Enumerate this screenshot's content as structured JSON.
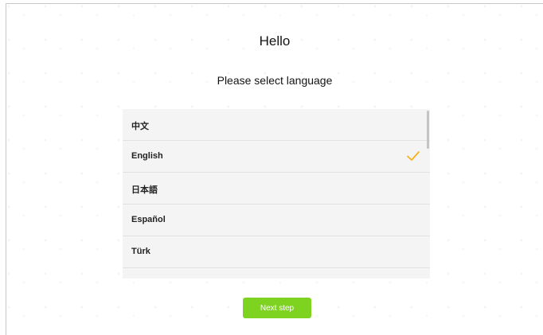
{
  "header": {
    "greeting": "Hello",
    "subtitle": "Please select language"
  },
  "languages": [
    {
      "label": "中文",
      "selected": false
    },
    {
      "label": "English",
      "selected": true
    },
    {
      "label": "日本語",
      "selected": false
    },
    {
      "label": "Español",
      "selected": false
    },
    {
      "label": "Türk",
      "selected": false
    }
  ],
  "next_button": {
    "label": "Next step"
  },
  "colors": {
    "accent": "#7ed321",
    "check": "#f5b21b",
    "list_background": "#f4f4f4"
  },
  "icons": {
    "selected_indicator": "check-icon"
  }
}
